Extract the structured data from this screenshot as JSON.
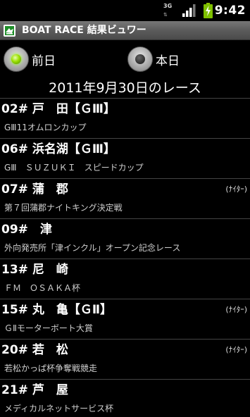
{
  "status_bar": {
    "network_label": "3G",
    "network_icon": "network-3g-icon",
    "signal_icon": "signal-strength-icon",
    "battery_icon": "battery-charging-icon",
    "time": "9:42"
  },
  "title_bar": {
    "icon": "app-icon",
    "title": "BOAT RACE 結果ビュワー"
  },
  "day_selector": {
    "options": [
      {
        "label": "前日",
        "checked": true
      },
      {
        "label": "本日",
        "checked": false
      }
    ],
    "accent_color": "#9be000"
  },
  "date_heading": "2011年9月30日のレース",
  "races": [
    {
      "name": "02# 戸　田【ＧⅢ】",
      "tag": "",
      "subtitle": "GⅢ11オムロンカップ"
    },
    {
      "name": "06# 浜名湖【ＧⅢ】",
      "tag": "",
      "subtitle": "GⅢ　ＳＵＺＵＫＩ　スピードカップ"
    },
    {
      "name": "07# 蒲　郡",
      "tag": "(ﾅｲﾀｰ)",
      "subtitle": "第７回蒲郡ナイトキング決定戦"
    },
    {
      "name": "09#　津",
      "tag": "",
      "subtitle": "外向発売所「津インクル」オープン記念レース"
    },
    {
      "name": "13# 尼　崎",
      "tag": "",
      "subtitle": "ＦＭ　ＯＳＡＫＡ杯"
    },
    {
      "name": "15# 丸　亀【ＧⅡ】",
      "tag": "(ﾅｲﾀｰ)",
      "subtitle": "ＧⅡモーターボート大賞"
    },
    {
      "name": "20# 若　松",
      "tag": "(ﾅｲﾀｰ)",
      "subtitle": "若松かっぱ杯争奪戦競走"
    },
    {
      "name": "21# 芦　屋",
      "tag": "",
      "subtitle": "メディカルネットサービス杯"
    }
  ]
}
